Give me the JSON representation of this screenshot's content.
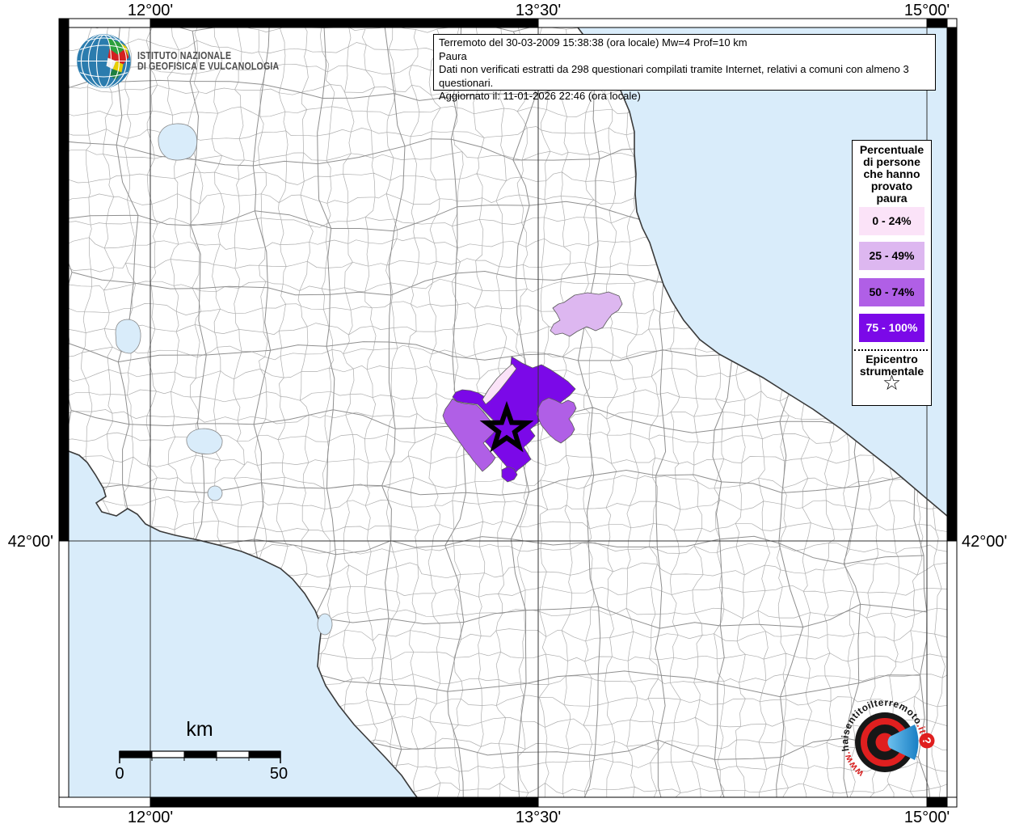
{
  "axis": {
    "top": [
      "12°00'",
      "13°30'",
      "15°00'"
    ],
    "bottom": [
      "12°00'",
      "13°30'",
      "15°00'"
    ],
    "left": "42°00'",
    "right": "42°00'"
  },
  "title_box": {
    "line1": "Terremoto del 30-03-2009 15:38:38 (ora locale) Mw=4 Prof=10 km",
    "line2": "Paura",
    "line3": "Dati non verificati estratti da 298 questionari compilati tramite Internet, relativi a comuni con almeno 3 questionari.",
    "line4": "Aggiornato il: 11-01-2026 22:46 (ora locale)"
  },
  "ingv": {
    "name_line1": "ISTITUTO NAZIONALE",
    "name_line2": "DI GEOFISICA E VULCANOLOGIA"
  },
  "legend": {
    "title_lines": [
      "Percentuale",
      "di persone",
      "che hanno",
      "provato",
      "paura"
    ],
    "classes": [
      {
        "label": "0 - 24%",
        "color": "#fbe3f8",
        "text_color": "#000000"
      },
      {
        "label": "25 - 49%",
        "color": "#ddb7f0",
        "text_color": "#000000"
      },
      {
        "label": "50 - 74%",
        "color": "#b05fe6",
        "text_color": "#000000"
      },
      {
        "label": "75 - 100%",
        "color": "#7b09e8",
        "text_color": "#ffffff"
      }
    ],
    "epicenter_line1": "Epicentro",
    "epicenter_line2": "strumentale",
    "epicenter_symbol": "☆"
  },
  "scalebar": {
    "unit": "km",
    "start_label": "0",
    "end_label": "50"
  },
  "site_logo": {
    "prefix": "www.",
    "domain": "haisentitoilterremoto",
    "tld": ".it",
    "badge": "?"
  },
  "map_colors": {
    "sea": "#d9ecfa",
    "land": "#ffffff",
    "grid": "#333333"
  }
}
